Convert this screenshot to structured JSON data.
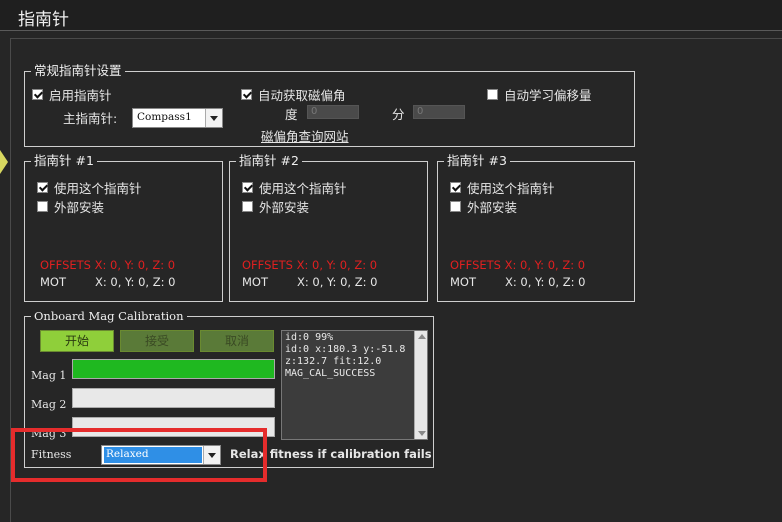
{
  "page": {
    "title": "指南针"
  },
  "general": {
    "group_title": "常规指南针设置",
    "enable_compass": {
      "label": "启用指南针",
      "checked": true
    },
    "primary_label": "主指南针:",
    "primary_value": "Compass1",
    "auto_declination": {
      "label": "自动获取磁偏角",
      "checked": true
    },
    "degree_label": "度",
    "degree_value": "0",
    "minute_label": "分",
    "minute_value": "0",
    "declination_link": "磁偏角查询网站",
    "auto_learn_offsets": {
      "label": "自动学习偏移量",
      "checked": false
    }
  },
  "compasses": [
    {
      "title": "指南针 #1",
      "use_label": "使用这个指南针",
      "use_checked": true,
      "external_label": "外部安装",
      "external_checked": false,
      "offsets": "OFFSETS  X: 0,   Y: 0,   Z: 0",
      "mot_label": "MOT",
      "mot_values": "X: 0,   Y: 0,   Z: 0"
    },
    {
      "title": "指南针 #2",
      "use_label": "使用这个指南针",
      "use_checked": true,
      "external_label": "外部安装",
      "external_checked": false,
      "offsets": "OFFSETS  X: 0,   Y: 0,   Z: 0",
      "mot_label": "MOT",
      "mot_values": "X: 0,   Y: 0,   Z: 0"
    },
    {
      "title": "指南针 #3",
      "use_label": "使用这个指南针",
      "use_checked": true,
      "external_label": "外部安装",
      "external_checked": false,
      "offsets": "OFFSETS  X: 0,   Y: 0,   Z: 0",
      "mot_label": "MOT",
      "mot_values": "X: 0,   Y: 0,   Z: 0"
    }
  ],
  "calibration": {
    "group_title": "Onboard Mag Calibration",
    "start_label": "开始",
    "accept_label": "接受",
    "cancel_label": "取消",
    "mags": [
      {
        "label": "Mag 1",
        "progress": 1.0
      },
      {
        "label": "Mag 2",
        "progress": 0.0
      },
      {
        "label": "Mag 3",
        "progress": 0.0
      }
    ],
    "log_lines": [
      "id:0 99%",
      "id:0 x:180.3 y:-51.8",
      "z:132.7 fit:12.0",
      "MAG_CAL_SUCCESS"
    ],
    "fitness_label": "Fitness",
    "fitness_value": "Relaxed",
    "relax_text": "Relax fitness if calibration fails"
  },
  "colors": {
    "accent_green": "#8fcf3a",
    "progress_green": "#1fb820",
    "offsets_red": "#e02020",
    "highlight_red": "#e52c2c"
  }
}
